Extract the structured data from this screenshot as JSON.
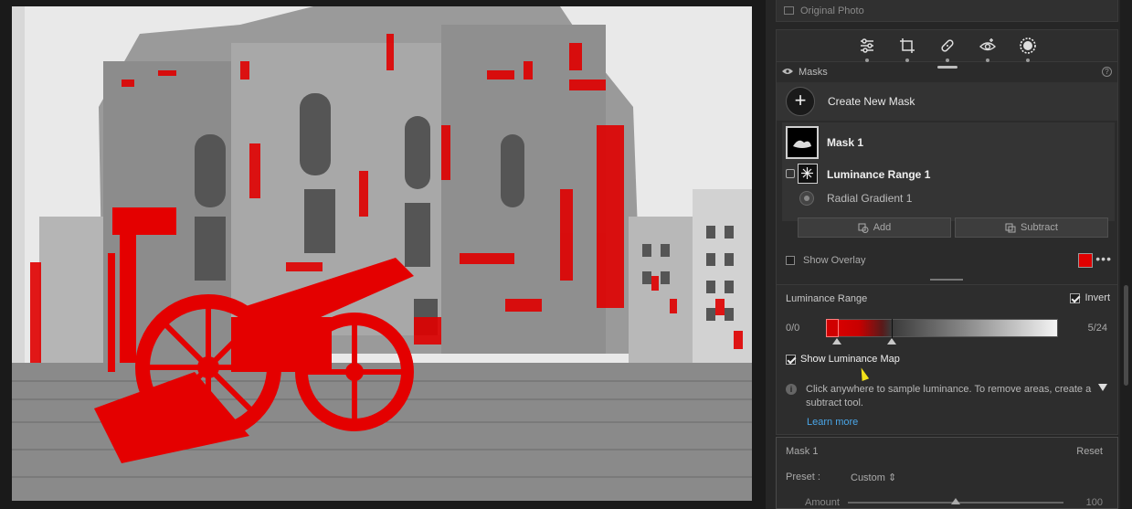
{
  "photo": {
    "description_icon": "photo-canvas"
  },
  "panel": {
    "original_photo_label": "Original Photo",
    "toolbar_icons": [
      "sliders-icon",
      "crop-icon",
      "healing-icon",
      "redeye-icon",
      "masking-icon"
    ]
  },
  "masks": {
    "header": "Masks",
    "help": "?",
    "create_plus": "+",
    "create_label": "Create New Mask",
    "mask_name": "Mask 1",
    "components": [
      "Luminance Range 1",
      "Radial Gradient 1"
    ],
    "add_label": "Add",
    "subtract_label": "Subtract",
    "show_overlay_label": "Show Overlay",
    "overlay_color": "#e00000",
    "more": "•••"
  },
  "luminance": {
    "title": "Luminance Range",
    "invert_label": "Invert",
    "invert_checked": true,
    "left_value": "0/0",
    "right_value": "5/24",
    "show_map_label": "Show Luminance Map",
    "show_map_checked": true,
    "info_icon": "i",
    "info_text": "Click anywhere to sample luminance. To remove areas, create a subtract tool.",
    "learn_more": "Learn more"
  },
  "mask_settings": {
    "title": "Mask 1",
    "reset": "Reset",
    "preset_label": "Preset :",
    "preset_value": "Custom ⇕",
    "amount_label": "Amount",
    "amount_value": "100"
  }
}
